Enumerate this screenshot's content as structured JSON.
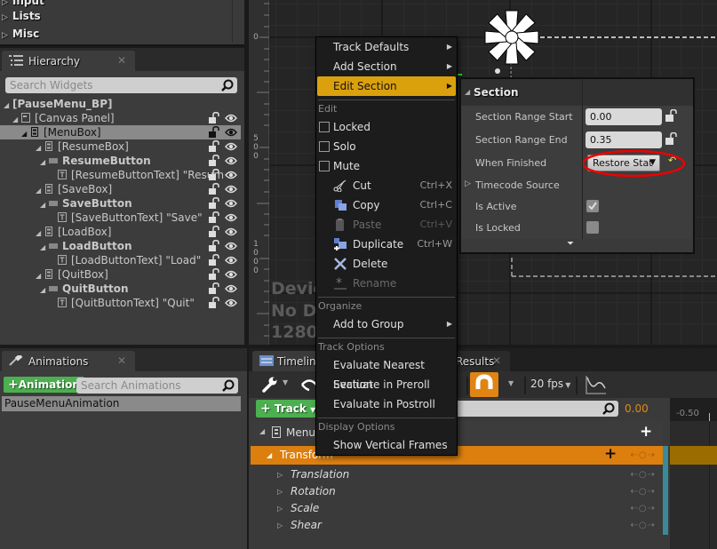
{
  "palette": {
    "items": [
      {
        "label": "Input"
      },
      {
        "label": "Lists"
      },
      {
        "label": "Misc"
      }
    ]
  },
  "hierarchy": {
    "tab_label": "Hierarchy",
    "search_placeholder": "Search Widgets",
    "rows": [
      {
        "label": "[PauseMenu_BP]",
        "bold": true
      },
      {
        "label": "[Canvas Panel]"
      },
      {
        "label": "[MenuBox]",
        "selected": true
      },
      {
        "label": "[ResumeBox]"
      },
      {
        "label": "ResumeButton",
        "bold": true
      },
      {
        "label": "[ResumeButtonText] \"Resum"
      },
      {
        "label": "[SaveBox]"
      },
      {
        "label": "SaveButton",
        "bold": true
      },
      {
        "label": "[SaveButtonText] \"Save\""
      },
      {
        "label": "[LoadBox]"
      },
      {
        "label": "LoadButton",
        "bold": true
      },
      {
        "label": "[LoadButtonText] \"Load\""
      },
      {
        "label": "[QuitBox]"
      },
      {
        "label": "QuitButton",
        "bold": true
      },
      {
        "label": "[QuitButtonText] \"Quit\""
      }
    ]
  },
  "animations": {
    "tab_label": "Animations",
    "add_button": "Animation",
    "search_placeholder": "Search Animations",
    "items": [
      "PauseMenuAnimation"
    ]
  },
  "designer": {
    "ruler_labels": [
      "0",
      "5\n0\n0",
      "1\n0\n0\n0"
    ],
    "overlay_lines": [
      "Device",
      "No De",
      "1280"
    ]
  },
  "context_menu": {
    "items_top": [
      {
        "label": "Track Defaults",
        "submenu": true
      },
      {
        "label": "Add Section",
        "submenu": true
      },
      {
        "label": "Edit Section",
        "submenu": true,
        "highlighted": true
      }
    ],
    "sections": {
      "edit": "Edit",
      "organize": "Organize",
      "track_options": "Track Options",
      "display_options": "Display Options"
    },
    "toggles": [
      {
        "label": "Locked",
        "checked": false
      },
      {
        "label": "Solo",
        "checked": false
      },
      {
        "label": "Mute",
        "checked": false
      }
    ],
    "actions": [
      {
        "label": "Cut",
        "shortcut": "Ctrl+X",
        "icon": "scissors-icon",
        "enabled": true
      },
      {
        "label": "Copy",
        "shortcut": "Ctrl+C",
        "icon": "copy-icon",
        "enabled": true
      },
      {
        "label": "Paste",
        "shortcut": "Ctrl+V",
        "icon": "paste-icon",
        "enabled": false
      },
      {
        "label": "Duplicate",
        "shortcut": "Ctrl+W",
        "icon": "duplicate-icon",
        "enabled": true
      },
      {
        "label": "Delete",
        "shortcut": "",
        "icon": "delete-icon",
        "enabled": true
      },
      {
        "label": "Rename",
        "shortcut": "",
        "icon": "rename-icon",
        "enabled": false
      }
    ],
    "organize": [
      {
        "label": "Add to Group",
        "submenu": true
      }
    ],
    "track_options": [
      {
        "label": "Evaluate Nearest Section"
      },
      {
        "label": "Evaluate in Preroll"
      },
      {
        "label": "Evaluate in Postroll"
      }
    ],
    "display_options": [
      {
        "label": "Show Vertical Frames"
      }
    ]
  },
  "section_panel": {
    "title": "Section",
    "range_start_label": "Section Range Start",
    "range_start_value": "0.00",
    "range_end_label": "Section Range End",
    "range_end_value": "0.35",
    "when_finished_label": "When Finished",
    "when_finished_value": "Restore Stat",
    "timecode_label": "Timecode Source",
    "is_active_label": "Is Active",
    "is_active": true,
    "is_locked_label": "Is Locked",
    "is_locked": false
  },
  "timeline": {
    "tab_label": "Timeline",
    "results_tab_label": "Results",
    "fps": "20 fps",
    "add_track": "Track",
    "current_time": "0.00",
    "ruler_label": "-0.50",
    "root_track": "MenuBox",
    "transform_track": "Transform",
    "sub_tracks": [
      "Translation",
      "Rotation",
      "Scale",
      "Shear"
    ],
    "highlight_color": "#dc7f0e"
  }
}
